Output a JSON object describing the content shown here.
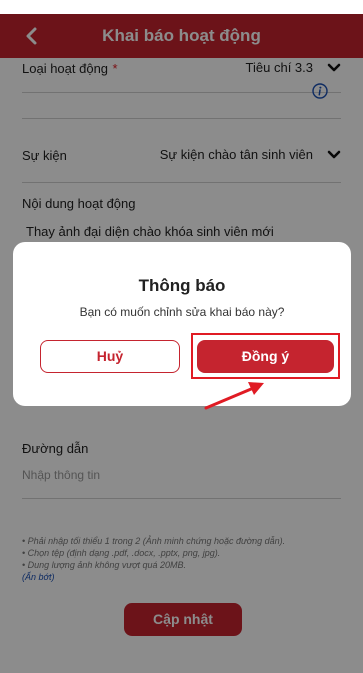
{
  "header": {
    "title": "Khai báo hoạt động",
    "back_icon": "chevron-left-icon"
  },
  "form": {
    "activity_type_label": "Loại hoạt động",
    "required_mark": "*",
    "activity_type_value": "Tiêu chí 3.3",
    "event_label": "Sự kiện",
    "event_value": "Sự kiện chào tân sinh viên",
    "content_label": "Nội dung hoạt động",
    "content_value": "Thay ảnh đại diện chào khóa sinh viên mới",
    "link_label": "Đường dẫn",
    "link_placeholder": "Nhập thông tin"
  },
  "notes": [
    "• Phải nhập tối thiểu 1 trong 2 (Ảnh minh chứng hoặc đường dẫn).",
    "• Chọn tệp (định dạng .pdf, .docx, .pptx, png, jpg).",
    "• Dung lượng ảnh không vượt quá 20MB."
  ],
  "notes_toggle": "(Ẩn bớt)",
  "update_button": "Cập nhật",
  "dialog": {
    "title": "Thông báo",
    "message": "Bạn có muốn chỉnh sửa khai báo này?",
    "cancel_label": "Huỷ",
    "confirm_label": "Đồng ý"
  },
  "colors": {
    "primary": "#c5242f",
    "highlight": "#e01b24",
    "info": "#1a4fb3"
  }
}
